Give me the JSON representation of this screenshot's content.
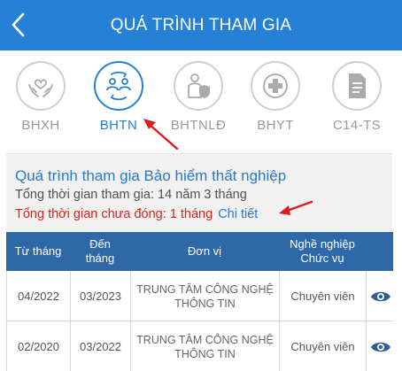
{
  "header": {
    "title": "QUÁ TRÌNH THAM GIA"
  },
  "tabs": [
    {
      "label": "BHXH",
      "icon": "heart-hands-icon",
      "active": false
    },
    {
      "label": "BHTN",
      "icon": "people-exchange-icon",
      "active": true
    },
    {
      "label": "BHTNLĐ",
      "icon": "worker-shield-icon",
      "active": false
    },
    {
      "label": "BHYT",
      "icon": "medical-cross-icon",
      "active": false
    },
    {
      "label": "C14-TS",
      "icon": "document-icon",
      "active": false
    }
  ],
  "summary": {
    "title": "Quá trình tham gia Bảo hiểm thất nghiệp",
    "total_time": "Tổng thời gian tham gia: 14 năm 3 tháng",
    "unpaid_time": "Tổng thời gian chưa đóng: 1 tháng",
    "detail_link": "Chi tiết"
  },
  "table": {
    "headers": {
      "from": "Từ tháng",
      "to_line1": "Đến",
      "to_line2": "tháng",
      "unit": "Đơn vị",
      "job_line1": "Nghề nghiệp",
      "job_line2": "Chức vụ"
    },
    "rows": [
      {
        "from": "04/2022",
        "to": "03/2023",
        "unit_line1": "TRUNG TÂM CÔNG NGHỆ",
        "unit_line2": "THÔNG TIN",
        "job": "Chuyên viên"
      },
      {
        "from": "02/2020",
        "to": "03/2022",
        "unit_line1": "TRUNG TÂM CÔNG NGHỆ",
        "unit_line2": "THÔNG TIN",
        "job": "Chuyên viên"
      }
    ]
  },
  "colors": {
    "header_bg": "#2580d6",
    "accent": "#2580d6",
    "table_header_bg": "#2f68a6",
    "unpaid_red": "#e0201b",
    "annotation_arrow": "#e01b1b"
  }
}
